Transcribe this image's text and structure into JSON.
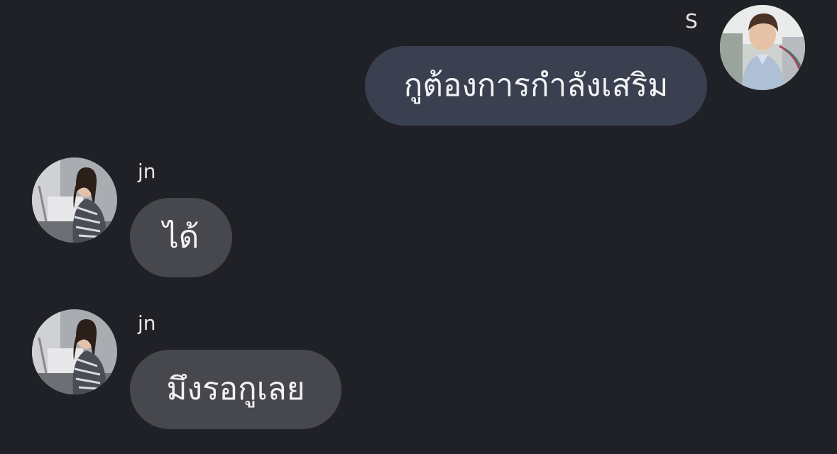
{
  "messages": [
    {
      "sender": "S",
      "direction": "outgoing",
      "text": "กูต้องการกำลังเสริม",
      "avatar_icon": "avatar-photo-man-light-shirt"
    },
    {
      "sender": "jn",
      "direction": "incoming",
      "text": "ได้",
      "avatar_icon": "avatar-photo-woman-patterned-dress"
    },
    {
      "sender": "jn",
      "direction": "incoming",
      "text": "มึงรอกูเลย",
      "avatar_icon": "avatar-photo-woman-patterned-dress"
    }
  ],
  "colors": {
    "background": "#202127",
    "outgoing_bubble": "#3a404f",
    "incoming_bubble": "#47484d",
    "text": "#f2f2f5"
  }
}
